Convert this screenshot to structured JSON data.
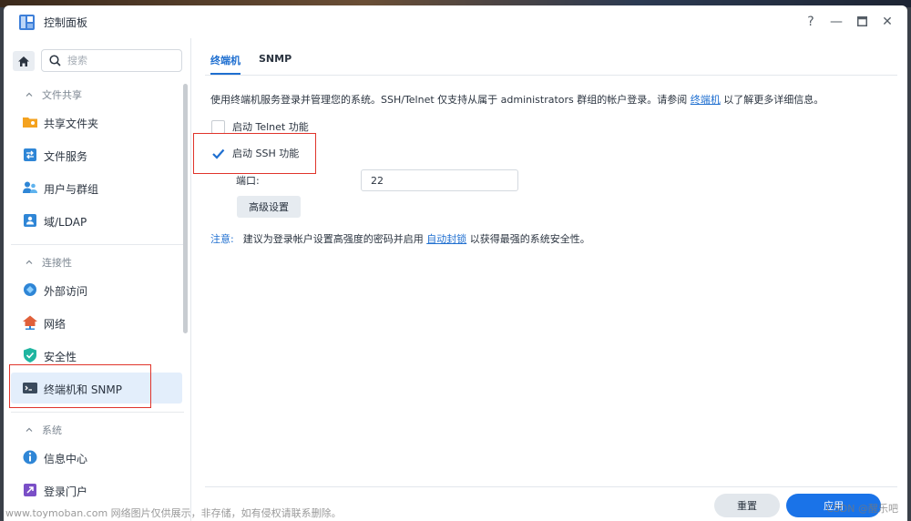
{
  "window": {
    "title": "控制面板",
    "help": "?",
    "minimize": "—",
    "maximize": "□",
    "close": "✕"
  },
  "sidebar": {
    "search_placeholder": "搜索",
    "groups": [
      {
        "title": "文件共享",
        "items": [
          {
            "label": "共享文件夹",
            "icon": "shared-folder-icon"
          },
          {
            "label": "文件服务",
            "icon": "file-services-icon"
          },
          {
            "label": "用户与群组",
            "icon": "users-groups-icon"
          },
          {
            "label": "域/LDAP",
            "icon": "domain-ldap-icon"
          }
        ]
      },
      {
        "title": "连接性",
        "items": [
          {
            "label": "外部访问",
            "icon": "external-access-icon"
          },
          {
            "label": "网络",
            "icon": "network-icon"
          },
          {
            "label": "安全性",
            "icon": "security-shield-icon"
          },
          {
            "label": "终端机和 SNMP",
            "icon": "terminal-icon",
            "active": true
          }
        ]
      },
      {
        "title": "系统",
        "items": [
          {
            "label": "信息中心",
            "icon": "info-center-icon"
          },
          {
            "label": "登录门户",
            "icon": "login-portal-icon"
          }
        ]
      }
    ]
  },
  "main": {
    "tabs": [
      {
        "label": "终端机",
        "active": true
      },
      {
        "label": "SNMP",
        "active": false
      }
    ],
    "description": {
      "text": "使用终端机服务登录并管理您的系统。SSH/Telnet 仅支持从属于 administrators 群组的帐户登录。请参阅 ",
      "link": "终端机",
      "suffix": " 以了解更多详细信息。"
    },
    "telnet": {
      "label": "启动 Telnet 功能",
      "checked": false
    },
    "ssh": {
      "label": "启动 SSH 功能",
      "checked": true
    },
    "port": {
      "label": "端口:",
      "value": "22"
    },
    "advanced_button": "高级设置",
    "note": {
      "label": "注意:",
      "text": "建议为登录帐户设置高强度的密码并启用 ",
      "link": "自动封锁",
      "suffix": " 以获得最强的系统安全性。"
    },
    "footer": {
      "reset": "重置",
      "apply": "应用"
    }
  },
  "overlay": {
    "watermark_left": "www.toymoban.com 网络图片仅供展示，非存储，如有侵权请联系删除。",
    "watermark_right": "CSDN @醒乐吧"
  },
  "colors": {
    "accent": "#1a73e8",
    "link": "#1f6fd0",
    "highlight_box": "#e0342b",
    "active_item_bg": "#e3eefb"
  }
}
